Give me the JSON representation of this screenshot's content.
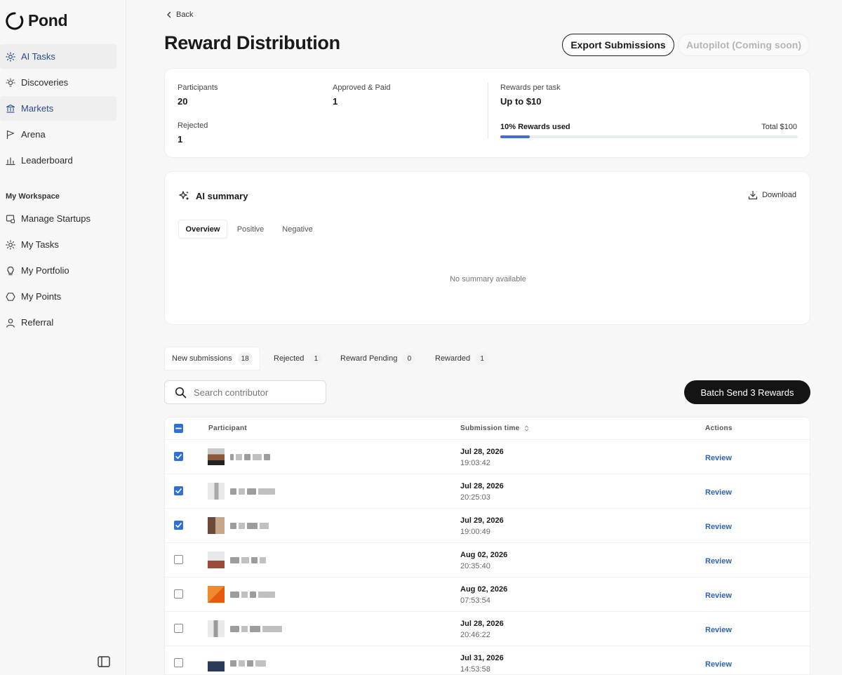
{
  "brand": {
    "name": "Pond"
  },
  "sidebar": {
    "items": [
      {
        "label": "AI Tasks",
        "icon": "sun-icon"
      },
      {
        "label": "Discoveries",
        "icon": "bulb-icon"
      },
      {
        "label": "Markets",
        "icon": "bank-icon"
      },
      {
        "label": "Arena",
        "icon": "flag-icon"
      },
      {
        "label": "Leaderboard",
        "icon": "bar-chart-icon"
      }
    ],
    "workspace_title": "My Workspace",
    "workspace_items": [
      {
        "label": "Manage Startups",
        "icon": "briefcase-icon"
      },
      {
        "label": "My Tasks",
        "icon": "sun-icon"
      },
      {
        "label": "My Portfolio",
        "icon": "bulb-icon"
      },
      {
        "label": "My Points",
        "icon": "hexagon-icon"
      },
      {
        "label": "Referral",
        "icon": "user-icon"
      }
    ]
  },
  "header": {
    "back_label": "Back",
    "title": "Reward Distribution",
    "export_label": "Export Submissions",
    "autopilot_label": "Autopilot (Coming soon)"
  },
  "stats": {
    "participants_label": "Participants",
    "participants_value": "20",
    "approved_label": "Approved & Paid",
    "approved_value": "1",
    "rejected_label": "Rejected",
    "rejected_value": "1",
    "rewards_per_task_label": "Rewards per task",
    "rewards_per_task_value": "Up to $10",
    "rewards_used_label": "10% Rewards used",
    "rewards_used_fraction": 0.1,
    "total_label": "Total $100",
    "accent_color": "#3f6fd8"
  },
  "summary": {
    "title": "AI summary",
    "download_label": "Download",
    "tabs": [
      "Overview",
      "Positive",
      "Negative"
    ],
    "active_tab": "Overview",
    "empty_text": "No summary available"
  },
  "submission_tabs": [
    {
      "label": "New submissions",
      "count": "18"
    },
    {
      "label": "Rejected",
      "count": "1"
    },
    {
      "label": "Reward Pending",
      "count": "0"
    },
    {
      "label": "Rewarded",
      "count": "1"
    }
  ],
  "search": {
    "placeholder": "Search contributor"
  },
  "batch_label": "Batch Send 3 Rewards",
  "table": {
    "headers": {
      "participant": "Participant",
      "submission_time": "Submission time",
      "actions": "Actions"
    },
    "rows": [
      {
        "checked": true,
        "date": "Jul 28, 2026",
        "time": "19:03:42",
        "action": "Review"
      },
      {
        "checked": true,
        "date": "Jul 28, 2026",
        "time": "20:25:03",
        "action": "Review"
      },
      {
        "checked": true,
        "date": "Jul 29, 2026",
        "time": "19:00:49",
        "action": "Review"
      },
      {
        "checked": false,
        "date": "Aug 02, 2026",
        "time": "20:35:40",
        "action": "Review"
      },
      {
        "checked": false,
        "date": "Aug 02, 2026",
        "time": "07:53:54",
        "action": "Review"
      },
      {
        "checked": false,
        "date": "Jul 28, 2026",
        "time": "20:46:22",
        "action": "Review"
      },
      {
        "checked": false,
        "date": "Jul 31, 2026",
        "time": "14:53:58",
        "action": "Review"
      }
    ]
  }
}
